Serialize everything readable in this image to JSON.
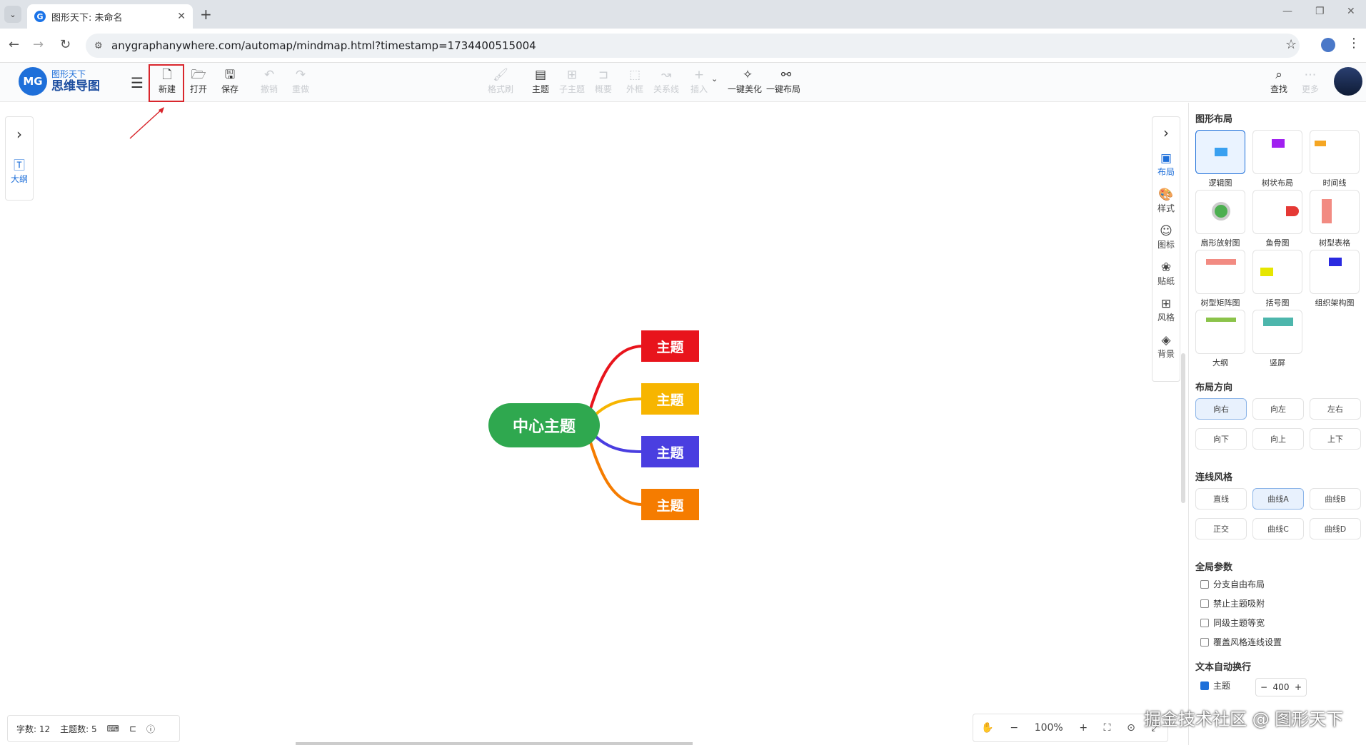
{
  "browser": {
    "tab_title": "图形天下: 未命名",
    "url": "anygraphanywhere.com/automap/mindmap.html?timestamp=1734400515004"
  },
  "app": {
    "logo_mark": "MG",
    "logo_line1": "图形天下",
    "logo_line2": "思维导图"
  },
  "toolbar": {
    "new": "新建",
    "open": "打开",
    "save": "保存",
    "undo": "撤销",
    "redo": "重做",
    "format_painter": "格式刷",
    "topic": "主题",
    "subtopic": "子主题",
    "summary": "概要",
    "boundary": "外框",
    "relation": "关系线",
    "insert": "插入",
    "beautify": "一键美化",
    "auto_layout": "一键布局",
    "search": "查找",
    "more": "更多"
  },
  "left_panel": {
    "outline": "大纲"
  },
  "right_bar": {
    "items": [
      "布局",
      "样式",
      "图标",
      "贴纸",
      "风格",
      "背景"
    ]
  },
  "mindmap": {
    "center": "中心主题",
    "branches": [
      {
        "label": "主题",
        "color": "#e8141c"
      },
      {
        "label": "主题",
        "color": "#f7b500"
      },
      {
        "label": "主题",
        "color": "#4a3ee0"
      },
      {
        "label": "主题",
        "color": "#f57c00"
      }
    ],
    "center_color": "#2fa84f"
  },
  "side_panel": {
    "layout_title": "图形布局",
    "layouts": [
      "逻辑图",
      "树状布局",
      "时间线",
      "扇形放射图",
      "鱼骨图",
      "树型表格",
      "树型矩阵图",
      "括号图",
      "组织架构图",
      "大纲",
      "竖屏"
    ],
    "direction_title": "布局方向",
    "directions": [
      "向右",
      "向左",
      "左右",
      "向下",
      "向上",
      "上下"
    ],
    "line_title": "连线风格",
    "lines": [
      "直线",
      "曲线A",
      "曲线B",
      "正交",
      "曲线C",
      "曲线D"
    ],
    "global_title": "全局参数",
    "global_options": [
      "分支自由布局",
      "禁止主题吸附",
      "同级主题等宽",
      "覆盖风格连线设置"
    ],
    "wrap_title": "文本自动换行",
    "wrap_topic": "主题",
    "wrap_value": "400"
  },
  "status": {
    "words": "字数: 12",
    "topics": "主题数: 5"
  },
  "zoom": {
    "value": "100%"
  },
  "watermark": "掘金技术社区 @ 图形天下"
}
